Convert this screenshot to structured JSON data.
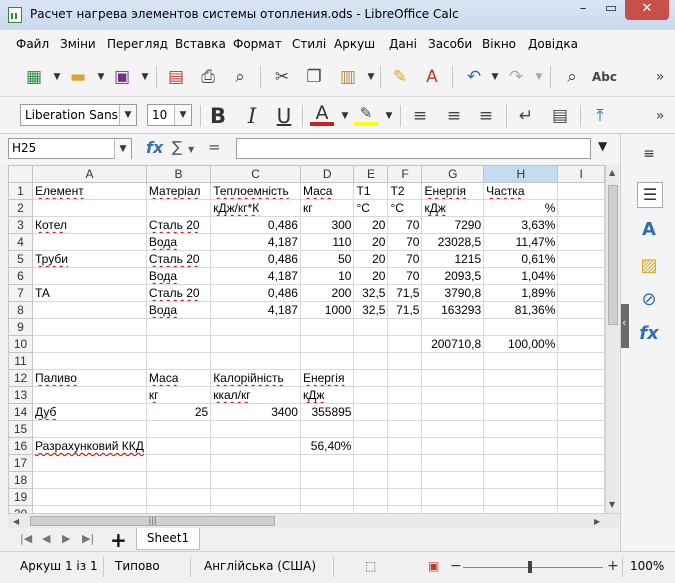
{
  "window": {
    "title": "Расчет нагрева элементов системы отопления.ods - LibreOffice Calc",
    "minimize": "–",
    "restore": "▭",
    "close": "✕"
  },
  "menu": [
    "Файл",
    "Зміни",
    "Перегляд",
    "Вставка",
    "Формат",
    "Стилі",
    "Аркуш",
    "Дані",
    "Засоби",
    "Вікно",
    "Довідка"
  ],
  "toolbar": {
    "font_name": "Liberation Sans",
    "font_size": "10",
    "bold": "B",
    "italic": "I",
    "underline": "U",
    "more": "»"
  },
  "formula_bar": {
    "cell_ref": "H25",
    "fx": "fx",
    "sum": "∑",
    "equals": "=",
    "content": ""
  },
  "sheet": {
    "columns": [
      "A",
      "B",
      "C",
      "D",
      "E",
      "F",
      "G",
      "H",
      "I"
    ],
    "rows": [
      [
        "Елемент",
        "Матеріал",
        "Теплоемність",
        "Маса",
        "T1",
        "T2",
        "Енергія",
        "Частка",
        ""
      ],
      [
        "",
        "",
        "кДж/кг*К",
        "кг",
        "°С",
        "°С",
        "кДж",
        "%",
        ""
      ],
      [
        "Котел",
        "Сталь 20",
        "0,486",
        "300",
        "20",
        "70",
        "7290",
        "3,63%",
        ""
      ],
      [
        "",
        "Вода",
        "4,187",
        "110",
        "20",
        "70",
        "23028,5",
        "11,47%",
        ""
      ],
      [
        "Труби",
        "Сталь 20",
        "0,486",
        "50",
        "20",
        "70",
        "1215",
        "0,61%",
        ""
      ],
      [
        "",
        "Вода",
        "4,187",
        "10",
        "20",
        "70",
        "2093,5",
        "1,04%",
        ""
      ],
      [
        "ТА",
        "Сталь 20",
        "0,486",
        "200",
        "32,5",
        "71,5",
        "3790,8",
        "1,89%",
        ""
      ],
      [
        "",
        "Вода",
        "4,187",
        "1000",
        "32,5",
        "71,5",
        "163293",
        "81,36%",
        ""
      ],
      [
        "",
        "",
        "",
        "",
        "",
        "",
        "",
        "",
        ""
      ],
      [
        "",
        "",
        "",
        "",
        "",
        "",
        "200710,8",
        "100,00%",
        ""
      ],
      [
        "",
        "",
        "",
        "",
        "",
        "",
        "",
        "",
        ""
      ],
      [
        "Паливо",
        "Маса",
        "Калорійність",
        "Енергія",
        "",
        "",
        "",
        "",
        ""
      ],
      [
        "",
        "кг",
        "ккал/кг",
        "кДж",
        "",
        "",
        "",
        "",
        ""
      ],
      [
        "Дуб",
        "25",
        "3400",
        "355895",
        "",
        "",
        "",
        "",
        ""
      ],
      [
        "",
        "",
        "",
        "",
        "",
        "",
        "",
        "",
        ""
      ],
      [
        "Разрахунковий ККД",
        "",
        "",
        "56,40%",
        "",
        "",
        "",
        "",
        ""
      ],
      [
        "",
        "",
        "",
        "",
        "",
        "",
        "",
        "",
        ""
      ],
      [
        "",
        "",
        "",
        "",
        "",
        "",
        "",
        "",
        ""
      ],
      [
        "",
        "",
        "",
        "",
        "",
        "",
        "",
        "",
        ""
      ],
      [
        "",
        "",
        "",
        "",
        "",
        "",
        "",
        "",
        ""
      ]
    ]
  },
  "tabs": {
    "add": "+",
    "sheets": [
      "Sheet1"
    ]
  },
  "status": {
    "sheet_pos": "Аркуш 1 із 1",
    "page_style": "Типово",
    "language": "Англійська (США)",
    "zoom": "100%"
  },
  "colors": {
    "selected_header": "#c4dcf2",
    "spell_underline": "#d00000",
    "accent": "#2f6cb3"
  }
}
